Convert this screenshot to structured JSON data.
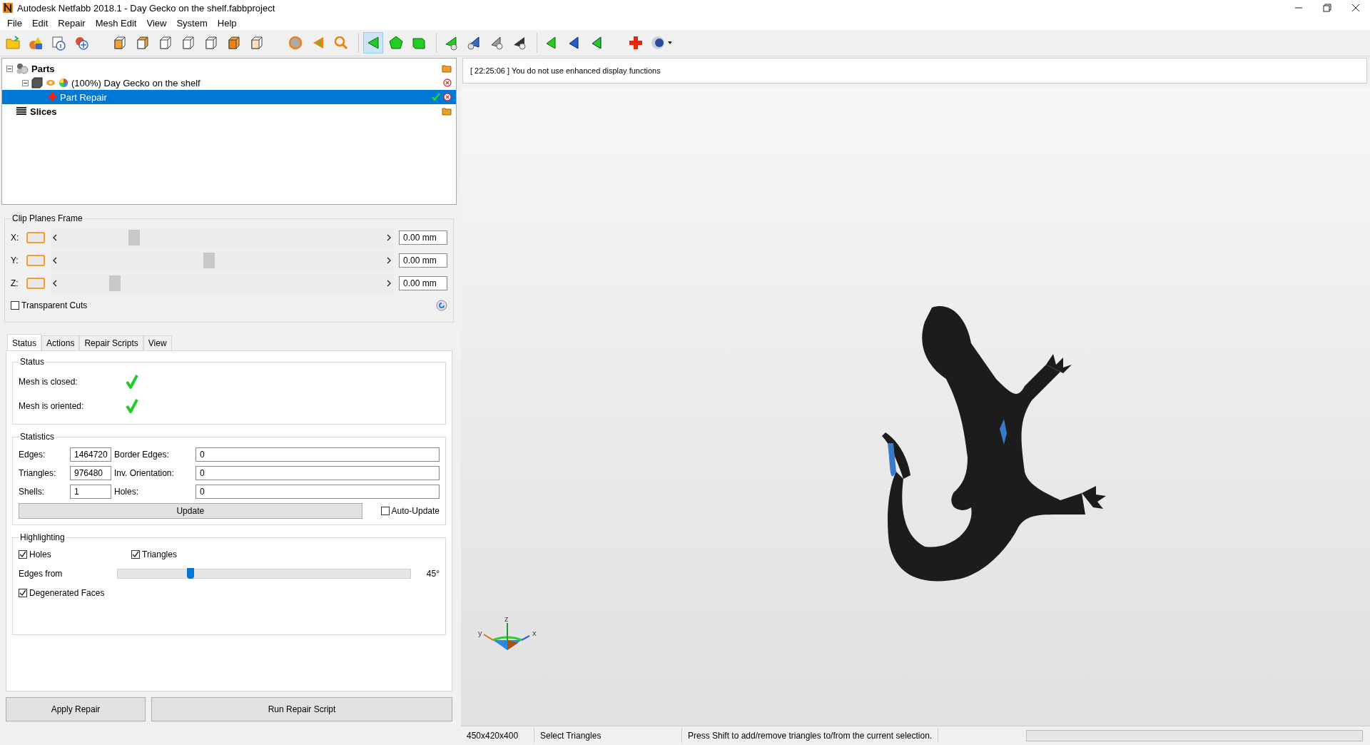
{
  "window": {
    "title": "Autodesk Netfabb 2018.1 - Day Gecko on the shelf.fabbproject"
  },
  "menu": [
    "File",
    "Edit",
    "Repair",
    "Mesh Edit",
    "View",
    "System",
    "Help"
  ],
  "tree": [
    {
      "label": "Parts",
      "kind": "group",
      "expanded": true,
      "selected": false,
      "children": [
        {
          "label": "(100%) Day Gecko on the shelf",
          "kind": "part",
          "expanded": true,
          "selected": false,
          "children": [
            {
              "label": "Part Repair",
              "kind": "repair",
              "selected": true
            }
          ]
        }
      ]
    },
    {
      "label": "Slices",
      "kind": "slices",
      "selected": false
    }
  ],
  "clip_planes": {
    "title": "Clip Planes Frame",
    "axes": [
      {
        "label": "X:",
        "on": false,
        "level": 0.23,
        "value": "0.00 mm"
      },
      {
        "label": "Y:",
        "on": false,
        "level": 0.46,
        "value": "0.00 mm"
      },
      {
        "label": "Z:",
        "on": false,
        "level": 0.17,
        "value": "0.00 mm"
      }
    ],
    "transparent_cuts": {
      "label": "Transparent Cuts",
      "checked": false
    }
  },
  "tabs": [
    {
      "label": "Status",
      "selected": true
    },
    {
      "label": "Actions",
      "selected": false
    },
    {
      "label": "Repair Scripts",
      "selected": false
    },
    {
      "label": "View",
      "selected": false
    }
  ],
  "status_group": {
    "title": "Status",
    "items": [
      {
        "label": "Mesh is closed:",
        "ok": true
      },
      {
        "label": "Mesh is oriented:",
        "ok": true
      }
    ]
  },
  "statistics": {
    "title": "Statistics",
    "rows": [
      {
        "label": "Edges:",
        "value": "1464720",
        "label_2": "Border Edges:",
        "value_2": "0"
      },
      {
        "label": "Triangles:",
        "value": "976480",
        "label_2": "Inv. Orientation:",
        "value_2": "0"
      },
      {
        "label": "Shells:",
        "value": "1",
        "label_2": "Holes:",
        "value_2": "0"
      }
    ],
    "update_button": "Update",
    "auto_update": {
      "label": "Auto-Update",
      "checked": false
    }
  },
  "highlighting": {
    "title": "Highlighting",
    "holes": {
      "label": "Holes",
      "checked": true
    },
    "triangles": {
      "label": "Triangles",
      "checked": true
    },
    "edges_from": {
      "label": "Edges from",
      "level": 0.25,
      "reading": "45°"
    },
    "degenerated_faces": {
      "label": "Degenerated Faces",
      "checked": true
    }
  },
  "buttons": [
    "Apply Repair",
    "Run Repair Script"
  ],
  "log": "[ 22:25:06 ] You do not use enhanced display functions",
  "axes_gizmo": {
    "x": "x",
    "y": "y",
    "z": "z"
  },
  "progress": {
    "level": 0
  },
  "status_bar": [
    "450x420x400",
    "Select Triangles",
    "Press Shift to add/remove triangles to/from the current selection."
  ]
}
